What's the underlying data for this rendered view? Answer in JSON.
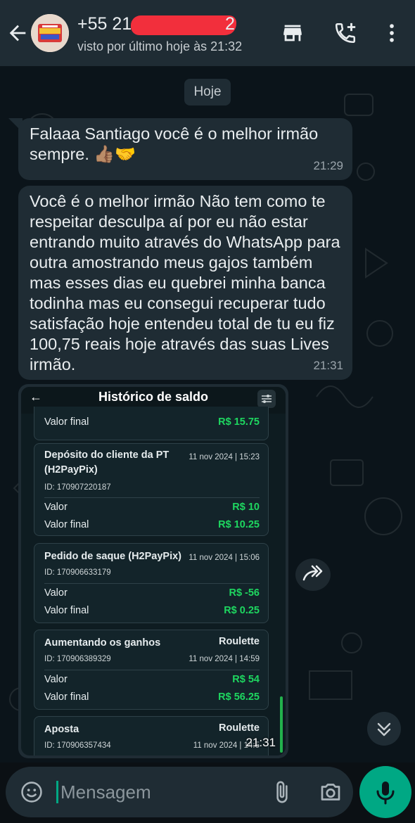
{
  "header": {
    "contact_name_prefix": "+55 21",
    "contact_name_suffix": "2",
    "last_seen": "visto por último hoje às 21:32",
    "icons": [
      "back-arrow-icon",
      "store-icon",
      "add-call-icon",
      "more-vert-icon"
    ]
  },
  "chat": {
    "date_chip": "Hoje",
    "messages": [
      {
        "text": "Falaaa Santiago você é o melhor irmão sempre.",
        "emoji": "👍🏽🤝",
        "time": "21:29"
      },
      {
        "text": "Você é o melhor irmão Não tem como te respeitar desculpa aí por eu não estar entrando muito através do WhatsApp para outra amostrando meus gajos também mas esses dias eu quebrei minha banca todinha mas eu consegui recuperar tudo satisfação hoje entendeu total de tu eu fiz 100,75 reais hoje através das suas Lives irmão.",
        "time": "21:31"
      }
    ],
    "image_message": {
      "time": "21:31",
      "screenshot": {
        "title": "Histórico de saldo",
        "partial_card": {
          "label": "Valor final",
          "value": "R$ 15.75"
        },
        "cards": [
          {
            "title": "Depósito do cliente da PT (H2PayPix)",
            "right": "",
            "date": "11 nov 2024 | 15:23",
            "id": "ID: 170907220187",
            "valor_label": "Valor",
            "valor": "R$ 10",
            "final_label": "Valor final",
            "final": "R$ 10.25"
          },
          {
            "title": "Pedido de saque (H2PayPix)",
            "right": "",
            "date": "11 nov 2024 | 15:06",
            "id": "ID: 170906633179",
            "valor_label": "Valor",
            "valor": "R$ -56",
            "final_label": "Valor final",
            "final": "R$ 0.25"
          },
          {
            "title": "Aumentando os ganhos",
            "right": "Roulette",
            "date": "11 nov 2024 | 14:59",
            "id": "ID: 170906389329",
            "valor_label": "Valor",
            "valor": "R$ 54",
            "final_label": "Valor final",
            "final": "R$ 56.25"
          },
          {
            "title": "Aposta",
            "right": "Roulette",
            "date": "11 nov 2024 | 14:5",
            "id": "ID: 170906357434"
          }
        ]
      }
    }
  },
  "input": {
    "placeholder": "Mensagem",
    "icons": [
      "emoji-icon",
      "attach-icon",
      "camera-icon",
      "mic-icon"
    ]
  },
  "colors": {
    "header_bg": "#1f2c34",
    "chat_bg": "#0b141a",
    "bubble_bg": "#1f2c34",
    "accent": "#00a884",
    "value_green": "#1ed760",
    "redaction": "#f22f3c"
  }
}
